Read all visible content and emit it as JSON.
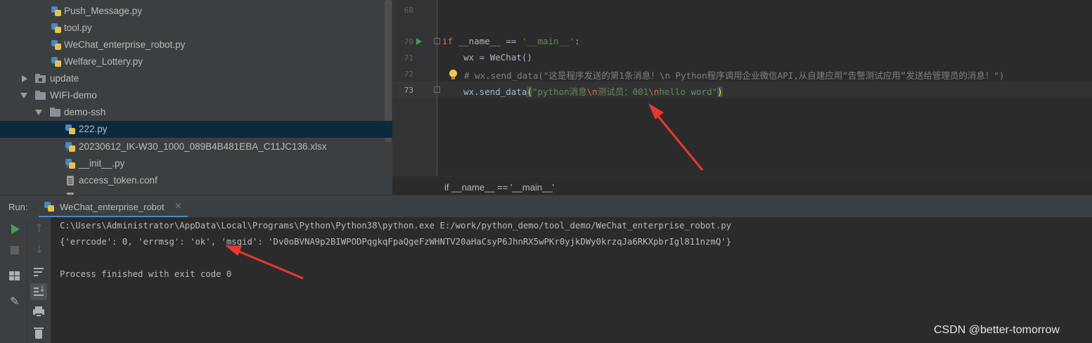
{
  "project_tree": {
    "items": [
      {
        "label": "Push_Message.py",
        "kind": "py"
      },
      {
        "label": "tool.py",
        "kind": "py"
      },
      {
        "label": "WeChat_enterprise_robot.py",
        "kind": "py"
      },
      {
        "label": "Welfare_Lottery.py",
        "kind": "py"
      },
      {
        "label": "update",
        "kind": "folder",
        "state": "collapsed"
      },
      {
        "label": "WIFI-demo",
        "kind": "folder",
        "state": "expanded"
      },
      {
        "label": "demo-ssh",
        "kind": "folder",
        "state": "expanded"
      },
      {
        "label": "222.py",
        "kind": "py",
        "selected": true
      },
      {
        "label": "20230612_IK-W30_1000_089B4B481EBA_C11JC136.xlsx",
        "kind": "unknown"
      },
      {
        "label": "__init__.py",
        "kind": "py"
      },
      {
        "label": "access_token.conf",
        "kind": "conf"
      }
    ]
  },
  "editor": {
    "line_numbers": [
      "68",
      "70",
      "71",
      "72",
      "73"
    ],
    "lines": {
      "l70_kw": "if",
      "l70_name": " __name__ == ",
      "l70_str": "'__main__'",
      "l70_colon": ":",
      "l71": "    wx = WeChat()",
      "l72_comment": "# wx.send_data(\"这是程序发送的第1条消息！\\n Python程序调用企业微信API,从自建应用“告警测试应用”发送给管理员的消息！\")",
      "l73_call": "    wx.send_data",
      "l73_open": "(",
      "l73_str_a": "\"python消息",
      "l73_esc_a": "\\n",
      "l73_str_b": "测试员：001",
      "l73_esc_b": "\\n",
      "l73_str_c": "hello word\"",
      "l73_close": ")"
    },
    "breadcrumb": "if __name__ == '__main__'"
  },
  "run_panel": {
    "title": "Run:",
    "tab_label": "WeChat_enterprise_robot",
    "tab_close": "×",
    "console_lines": [
      "C:\\Users\\Administrator\\AppData\\Local\\Programs\\Python\\Python38\\python.exe E:/work/python_demo/tool_demo/WeChat_enterprise_robot.py",
      "{'errcode': 0, 'errmsg': 'ok', 'msgid': 'Dv0oBVNA9p2BIWPODPqgkqFpaQgeFzWHNTV20aHaCsyP6JhnRX5wPKr0yjkDWy0krzqJa6RKXpbrIgl811nzmQ'}",
      "",
      "Process finished with exit code 0"
    ]
  },
  "watermark": "CSDN @better-tomorrow",
  "colors": {
    "annotation_arrow": "#e8382f",
    "keyword": "#cc7832",
    "string": "#6a8759",
    "comment": "#808080"
  }
}
